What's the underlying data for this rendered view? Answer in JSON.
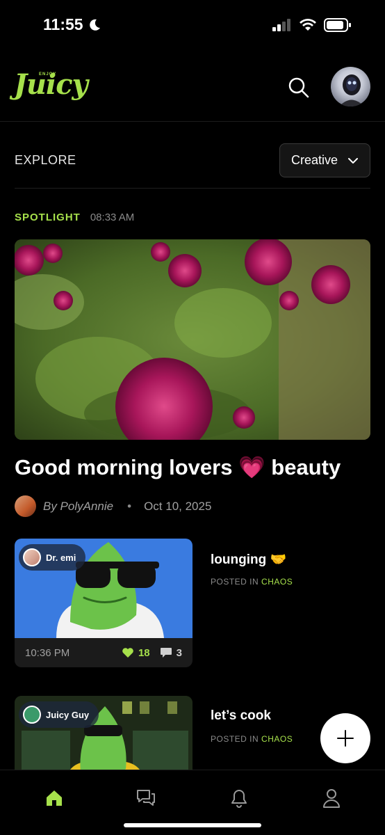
{
  "status_bar": {
    "time": "11:55"
  },
  "header": {
    "logo_tagline": "ENJOY",
    "logo_text": "Juicy"
  },
  "explore": {
    "label": "EXPLORE",
    "filter_selected": "Creative"
  },
  "spotlight": {
    "tag": "SPOTLIGHT",
    "time": "08:33 AM",
    "title": "Good morning lovers 💗 beauty",
    "author": "By PolyAnnie",
    "separator": "•",
    "date": "Oct 10, 2025"
  },
  "posts": [
    {
      "author": "Dr. emi",
      "title": "lounging 🤝",
      "posted_in_label": "POSTED IN",
      "category": "CHAOS",
      "time": "10:36 PM",
      "likes": "18",
      "comments": "3"
    },
    {
      "author": "Juicy Guy",
      "title": "let’s cook",
      "posted_in_label": "POSTED IN",
      "category": "CHAOS"
    }
  ],
  "colors": {
    "accent": "#a6e04b",
    "background": "#000000",
    "card": "#1b1b1b"
  },
  "icons": [
    "moon-icon",
    "signal-icon",
    "wifi-icon",
    "battery-icon",
    "search-icon",
    "chevron-down-icon",
    "heart-icon",
    "comment-icon",
    "plus-icon",
    "home-icon",
    "chat-icon",
    "bell-icon",
    "profile-icon"
  ]
}
